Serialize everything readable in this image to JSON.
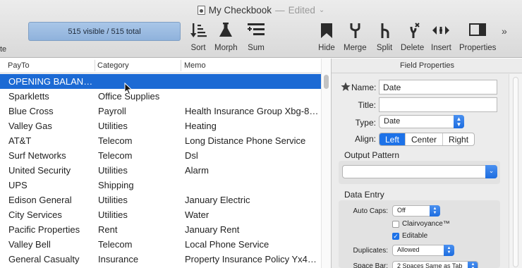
{
  "window": {
    "title": "My Checkbook",
    "separator": "—",
    "status": "Edited",
    "status_chevron": "⌄"
  },
  "toolbar": {
    "edge_label": "te",
    "record_count": "515 visible / 515 total",
    "items": [
      {
        "label": "Sort",
        "icon": "sort-icon"
      },
      {
        "label": "Morph",
        "icon": "flask-icon"
      },
      {
        "label": "Sum",
        "icon": "sum-icon"
      },
      {
        "label": "Hide",
        "icon": "bookmark-icon"
      },
      {
        "label": "Merge",
        "icon": "merge-icon"
      },
      {
        "label": "Split",
        "icon": "split-icon"
      },
      {
        "label": "Delete",
        "icon": "delete-icon"
      },
      {
        "label": "Insert",
        "icon": "insert-icon"
      },
      {
        "label": "Properties",
        "icon": "sidebar-icon"
      }
    ],
    "overflow": "»"
  },
  "table": {
    "columns": [
      "PayTo",
      "Category",
      "Memo"
    ],
    "rows": [
      {
        "payto": "OPENING BALAN…",
        "category": "",
        "memo": ""
      },
      {
        "payto": "Sparkletts",
        "category": "Office Supplies",
        "memo": ""
      },
      {
        "payto": "Blue Cross",
        "category": "Payroll",
        "memo": "Health Insurance Group Xbg-8…"
      },
      {
        "payto": "Valley Gas",
        "category": "Utilities",
        "memo": "Heating"
      },
      {
        "payto": "AT&T",
        "category": "Telecom",
        "memo": "Long Distance Phone Service"
      },
      {
        "payto": "Surf Networks",
        "category": "Telecom",
        "memo": "Dsl"
      },
      {
        "payto": "United Security",
        "category": "Utilities",
        "memo": "Alarm"
      },
      {
        "payto": "UPS",
        "category": "Shipping",
        "memo": ""
      },
      {
        "payto": "Edison General",
        "category": "Utilities",
        "memo": "January Electric"
      },
      {
        "payto": "City Services",
        "category": "Utilities",
        "memo": "Water"
      },
      {
        "payto": "Pacific Properties",
        "category": "Rent",
        "memo": "January Rent"
      },
      {
        "payto": "Valley Bell",
        "category": "Telecom",
        "memo": "Local Phone Service"
      },
      {
        "payto": "General Casualty",
        "category": "Insurance",
        "memo": "Property Insurance Policy Yx4…"
      }
    ],
    "selected_row": 0
  },
  "properties": {
    "title": "Field Properties",
    "name_label": "Name:",
    "name_value": "Date",
    "title_label": "Title:",
    "title_value": "",
    "type_label": "Type:",
    "type_value": "Date",
    "align_label": "Align:",
    "align_options": [
      "Left",
      "Center",
      "Right"
    ],
    "align_selected": "Left",
    "output_pattern_label": "Output Pattern",
    "output_pattern_value": "",
    "data_entry_label": "Data Entry",
    "auto_caps_label": "Auto Caps:",
    "auto_caps_value": "Off",
    "clairvoyance_label": "Clairvoyance™",
    "clairvoyance_checked": false,
    "editable_label": "Editable",
    "editable_checked": true,
    "duplicates_label": "Duplicates:",
    "duplicates_value": "Allowed",
    "space_bar_label": "Space Bar:",
    "space_bar_value": "2 Spaces Same as Tab"
  },
  "colors": {
    "selection": "#1c6ad4",
    "accent": "#1d72e8",
    "count_box": "#9dbde4"
  }
}
